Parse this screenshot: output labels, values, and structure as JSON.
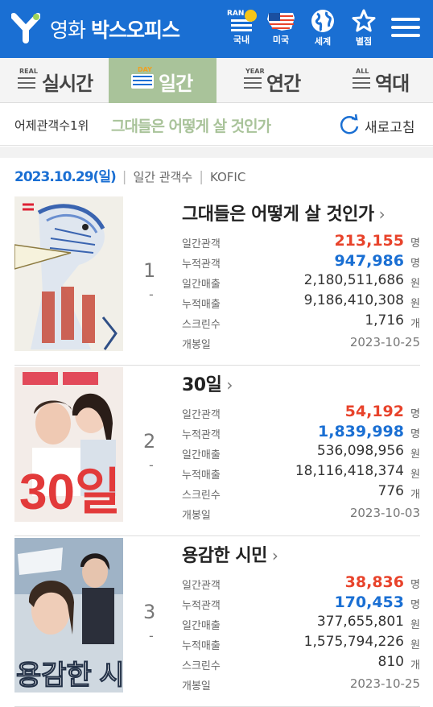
{
  "header": {
    "brand_light": "영화",
    "brand_bold": "박스오피스",
    "ran_badge": "RAN",
    "nav": [
      {
        "label": "국내",
        "icon": "rank-list-icon"
      },
      {
        "label": "미국",
        "icon": "us-flag-icon"
      },
      {
        "label": "세계",
        "icon": "globe-icon"
      },
      {
        "label": "별점",
        "icon": "star-icon"
      }
    ],
    "accent": "#1a6fd3"
  },
  "tabs": [
    {
      "sup": "REAL",
      "label": "실시간",
      "active": false
    },
    {
      "sup": "DAY",
      "label": "일간",
      "active": true
    },
    {
      "sup": "YEAR",
      "label": "연간",
      "active": false
    },
    {
      "sup": "ALL",
      "label": "역대",
      "active": false
    }
  ],
  "yesterday": {
    "label": "어제관객수1위",
    "title": "그대들은 어떻게 살 것인가",
    "refresh_label": "새로고침"
  },
  "date_row": {
    "date": "2023.10.29(일)",
    "metric": "일간 관객수",
    "source": "KOFIC"
  },
  "stat_labels": {
    "daily_audience": "일간관객",
    "total_audience": "누적관객",
    "daily_sales": "일간매출",
    "total_sales": "누적매출",
    "screens": "스크린수",
    "release": "개봉일"
  },
  "units": {
    "people": "명",
    "won": "원",
    "count": "개"
  },
  "movies": [
    {
      "rank": "1",
      "change": "-",
      "title": "그대들은 어떻게 살 것인가",
      "daily_audience": "213,155",
      "total_audience": "947,986",
      "daily_sales": "2,180,511,686",
      "total_sales": "9,186,410,308",
      "screens": "1,716",
      "release": "2023-10-25"
    },
    {
      "rank": "2",
      "change": "-",
      "title": "30일",
      "daily_audience": "54,192",
      "total_audience": "1,839,998",
      "daily_sales": "536,098,956",
      "total_sales": "18,116,418,374",
      "screens": "776",
      "release": "2023-10-03"
    },
    {
      "rank": "3",
      "change": "-",
      "title": "용감한 시민",
      "daily_audience": "38,836",
      "total_audience": "170,453",
      "daily_sales": "377,655,801",
      "total_sales": "1,575,794,226",
      "screens": "810",
      "release": "2023-10-25"
    }
  ]
}
